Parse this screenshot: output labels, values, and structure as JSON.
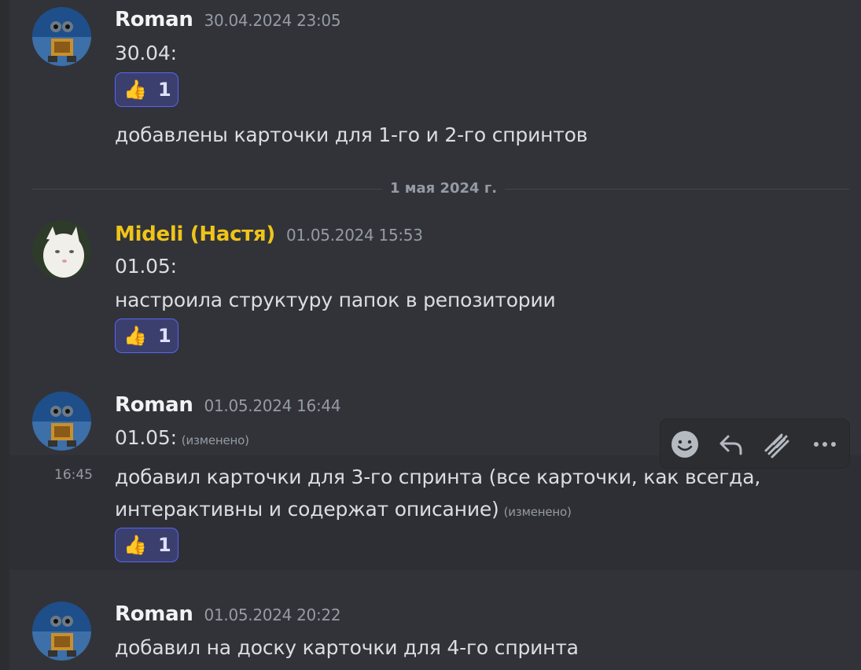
{
  "messages": [
    {
      "author": "Roman",
      "timestamp": "30.04.2024 23:05",
      "lines": [
        "30.04:"
      ],
      "reaction": {
        "emoji": "👍",
        "count": "1"
      },
      "extra_line": "добавлены карточки для 1-го и 2-го спринтов"
    },
    {
      "author": "Mideli (Настя)",
      "timestamp": "01.05.2024 15:53",
      "lines": [
        "01.05:",
        "настроила структуру папок в репозитории"
      ],
      "reaction": {
        "emoji": "👍",
        "count": "1"
      }
    },
    {
      "author": "Roman",
      "timestamp": "01.05.2024 16:44",
      "lines": [
        "01.05:"
      ],
      "edited": "(изменено)",
      "followup": {
        "time": "16:45",
        "lines": [
          "добавил карточки для 3-го спринта (все карточки, как всегда,",
          "интерактивны и содержат описание)"
        ],
        "edited": "(изменено)",
        "reaction": {
          "emoji": "👍",
          "count": "1"
        }
      }
    },
    {
      "author": "Roman",
      "timestamp": "01.05.2024 20:22",
      "lines": [
        "добавил на доску карточки для 4-го спринта"
      ]
    }
  ],
  "date_divider": "1 мая 2024 г.",
  "toolbar": {
    "icons": [
      "add-reaction-icon",
      "reply-icon",
      "create-thread-icon",
      "more-icon"
    ]
  },
  "colors": {
    "background": "#323339",
    "reaction_bg": "#3b3f6e",
    "reaction_border": "#5865f2",
    "username_highlight": "#f0c419"
  }
}
